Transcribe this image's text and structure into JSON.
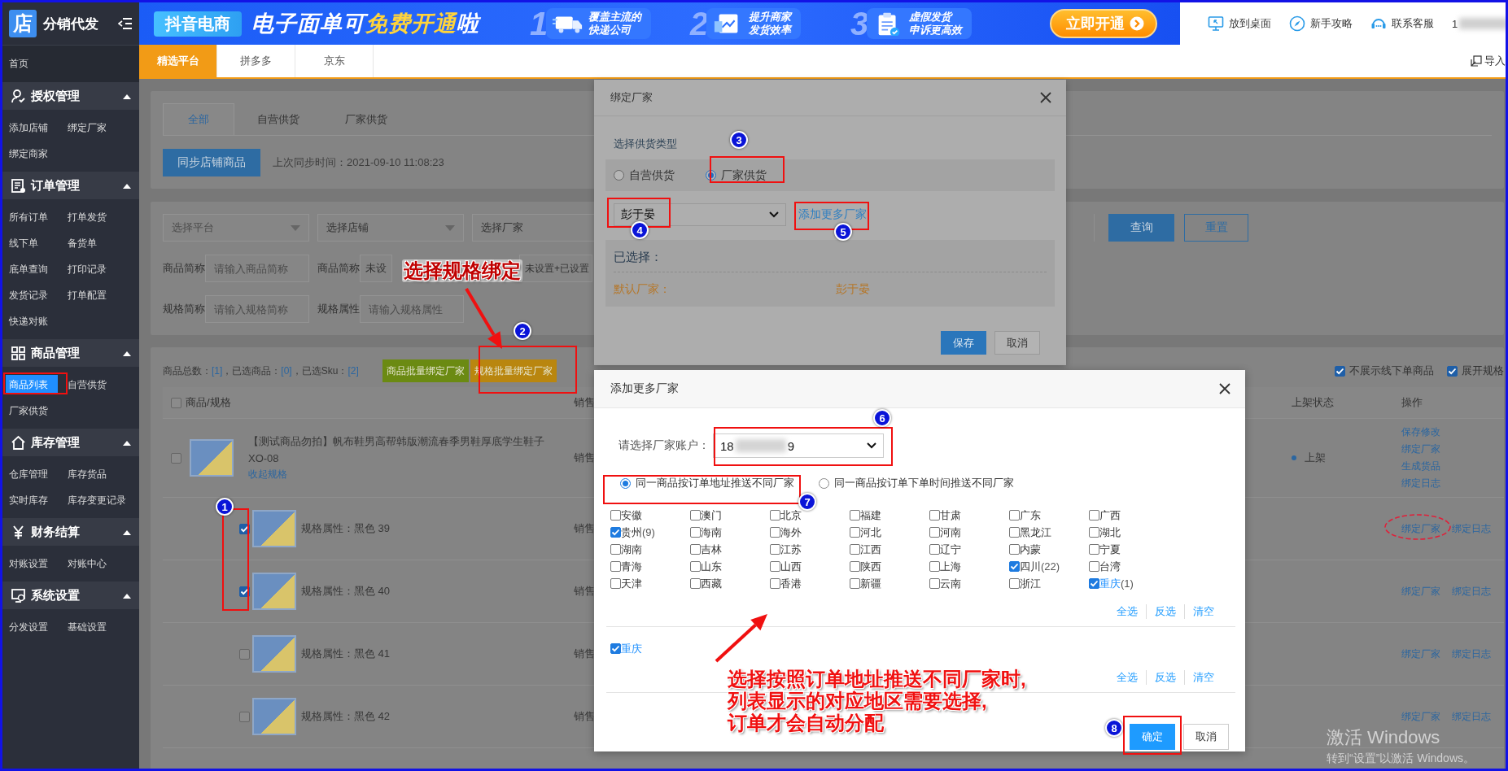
{
  "app": {
    "logo_glyph": "店",
    "title": "分销代发"
  },
  "banner": {
    "brand": "抖音电商",
    "headline": [
      {
        "text": "电子面单可",
        "highlight": false
      },
      {
        "text": "免费开通",
        "highlight": true
      },
      {
        "text": "啦",
        "highlight": false
      }
    ],
    "features": [
      {
        "number": "1",
        "lines": [
          "覆盖主流的",
          "快递公司"
        ]
      },
      {
        "number": "2",
        "lines": [
          "提升商家",
          "发货效率"
        ]
      },
      {
        "number": "3",
        "lines": [
          "虚假发货",
          "申诉更高效"
        ]
      }
    ],
    "cta": "立即开通"
  },
  "header_links": [
    {
      "label": "放到桌面"
    },
    {
      "label": "新手攻略"
    },
    {
      "label": "联系客服"
    }
  ],
  "user": {
    "phone_visible": "1"
  },
  "platform_tabs": [
    {
      "label": "精选平台",
      "selected": true
    },
    {
      "label": "拼多多",
      "selected": false
    },
    {
      "label": "京东",
      "selected": false
    }
  ],
  "import_button": "导入",
  "sidebar": {
    "home": "首页",
    "groups": [
      {
        "title": "授权管理",
        "expanded": true,
        "items": [
          {
            "label": "添加店铺",
            "selected": false
          },
          {
            "label": "绑定厂家",
            "selected": false
          },
          {
            "label": "绑定商家",
            "selected": false
          }
        ]
      },
      {
        "title": "订单管理",
        "expanded": true,
        "items": [
          {
            "label": "所有订单",
            "selected": false
          },
          {
            "label": "打单发货",
            "selected": false
          },
          {
            "label": "线下单",
            "selected": false
          },
          {
            "label": "备货单",
            "selected": false
          },
          {
            "label": "底单查询",
            "selected": false
          },
          {
            "label": "打印记录",
            "selected": false
          },
          {
            "label": "发货记录",
            "selected": false
          },
          {
            "label": "打单配置",
            "selected": false
          },
          {
            "label": "快递对账",
            "selected": false
          }
        ]
      },
      {
        "title": "商品管理",
        "expanded": true,
        "items": [
          {
            "label": "商品列表",
            "selected": true
          },
          {
            "label": "自营供货",
            "selected": false
          },
          {
            "label": "厂家供货",
            "selected": false
          }
        ]
      },
      {
        "title": "库存管理",
        "expanded": true,
        "items": [
          {
            "label": "仓库管理",
            "selected": false
          },
          {
            "label": "库存货品",
            "selected": false
          },
          {
            "label": "实时库存",
            "selected": false
          },
          {
            "label": "库存变更记录",
            "selected": false
          }
        ]
      },
      {
        "title": "财务结算",
        "expanded": true,
        "items": [
          {
            "label": "对账设置",
            "selected": false
          },
          {
            "label": "对账中心",
            "selected": false
          }
        ]
      },
      {
        "title": "系统设置",
        "expanded": true,
        "items": [
          {
            "label": "分发设置",
            "selected": false
          },
          {
            "label": "基础设置",
            "selected": false
          }
        ]
      }
    ]
  },
  "supply_tabs": [
    {
      "label": "全部",
      "selected": true
    },
    {
      "label": "自营供货",
      "selected": false
    },
    {
      "label": "厂家供货",
      "selected": false
    }
  ],
  "sync_button": "同步店铺商品",
  "last_sync": "上次同步时间：2021-09-10 11:08:23",
  "filters": {
    "rows": [
      {
        "fields": [
          {
            "kind": "select",
            "placeholder": "选择平台"
          },
          {
            "kind": "select",
            "value": "选择店铺"
          },
          {
            "kind": "select",
            "value": "选择厂家"
          }
        ]
      },
      {
        "fields": [
          {
            "kind": "label",
            "text": "商品简称"
          },
          {
            "kind": "input",
            "placeholder": "请输入商品简称"
          },
          {
            "kind": "label",
            "text": "商品简称"
          },
          {
            "kind": "select",
            "value": "未设"
          },
          {
            "kind": "select",
            "value": "未设置+已设置"
          }
        ]
      },
      {
        "fields": [
          {
            "kind": "label",
            "text": "规格简称"
          },
          {
            "kind": "input",
            "placeholder": "请输入规格简称"
          },
          {
            "kind": "label",
            "text": "规格属性"
          },
          {
            "kind": "input",
            "placeholder": "请输入规格属性"
          }
        ]
      }
    ],
    "query_button": "查询",
    "reset_button": "重置"
  },
  "table": {
    "summary": [
      {
        "text": "商品总数：",
        "kind": "label"
      },
      {
        "text": "[1]",
        "kind": "count"
      },
      {
        "text": "，已选商品：",
        "kind": "label"
      },
      {
        "text": "[0]",
        "kind": "count"
      },
      {
        "text": "，已选Sku：",
        "kind": "label"
      },
      {
        "text": "[2]",
        "kind": "count"
      }
    ],
    "batch_buttons": [
      {
        "label": "商品批量绑定厂家",
        "color": "#6b8a12"
      },
      {
        "label": "规格批量绑定厂家",
        "color": "#b9860f"
      }
    ],
    "options": [
      {
        "label": "不展示线下单商品",
        "checked": true
      },
      {
        "label": "展开规格",
        "checked": true
      }
    ],
    "header_checked": false,
    "columns": [
      "商品/规格",
      "销售",
      "上架状态",
      "操作"
    ],
    "product": {
      "checked": false,
      "title": "【测试商品勿拍】帆布鞋男高帮韩版潮流春季男鞋厚底学生鞋子",
      "code": "XO-08",
      "collapse_link": "收起规格",
      "column_2": "销售",
      "status": "上架",
      "actions": [
        "保存修改",
        "绑定厂家",
        "生成货品",
        "绑定日志"
      ]
    },
    "skus": [
      {
        "checked": true,
        "attribute": "规格属性：黑色 39",
        "column_2": "销售",
        "actions": [
          "绑定厂家",
          "绑定日志"
        ]
      },
      {
        "checked": true,
        "attribute": "规格属性：黑色 40",
        "column_2": "销售",
        "actions": [
          "绑定厂家",
          "绑定日志"
        ]
      },
      {
        "checked": false,
        "attribute": "规格属性：黑色 41",
        "column_2": "销售",
        "actions": [
          "绑定厂家",
          "绑定日志"
        ]
      },
      {
        "checked": false,
        "attribute": "规格属性：黑色 42",
        "column_2": "销售",
        "actions": [
          "绑定厂家",
          "绑定日志"
        ]
      }
    ]
  },
  "bind_dialog": {
    "title": "绑定厂家",
    "section_label": "选择供货类型",
    "supply_types": [
      {
        "label": "自营供货",
        "selected": false
      },
      {
        "label": "厂家供货",
        "selected": true
      }
    ],
    "factory_select": "彭于晏",
    "add_more_link": "添加更多厂家",
    "selected_label": "已选择：",
    "selected_rows": [
      {
        "label": "默认厂家：",
        "value": "彭于晏"
      }
    ],
    "buttons": [
      {
        "label": "保存",
        "kind": "primary"
      },
      {
        "label": "取消",
        "kind": "secondary"
      }
    ]
  },
  "more_dialog": {
    "title": "添加更多厂家",
    "account_label": "请选择厂家账户：",
    "account_visible_start": "18",
    "account_visible_end": "9",
    "push_modes": [
      {
        "label": "同一商品按订单地址推送不同厂家",
        "selected": true
      },
      {
        "label": "同一商品按订单下单时间推送不同厂家",
        "selected": false
      }
    ],
    "regions": [
      {
        "name": "安徽",
        "checked": false,
        "active": false
      },
      {
        "name": "澳门",
        "checked": false,
        "active": false
      },
      {
        "name": "北京",
        "checked": false,
        "active": false
      },
      {
        "name": "福建",
        "checked": false,
        "active": false
      },
      {
        "name": "甘肃",
        "checked": false,
        "active": false
      },
      {
        "name": "广东",
        "checked": false,
        "active": false
      },
      {
        "name": "广西",
        "checked": false,
        "active": false
      },
      {
        "name": "贵州",
        "count": "(9)",
        "checked": true,
        "active": false
      },
      {
        "name": "海南",
        "checked": false,
        "active": false
      },
      {
        "name": "海外",
        "checked": false,
        "active": false
      },
      {
        "name": "河北",
        "checked": false,
        "active": false
      },
      {
        "name": "河南",
        "checked": false,
        "active": false
      },
      {
        "name": "黑龙江",
        "checked": false,
        "active": false
      },
      {
        "name": "湖北",
        "checked": false,
        "active": false
      },
      {
        "name": "湖南",
        "checked": false,
        "active": false
      },
      {
        "name": "吉林",
        "checked": false,
        "active": false
      },
      {
        "name": "江苏",
        "checked": false,
        "active": false
      },
      {
        "name": "江西",
        "checked": false,
        "active": false
      },
      {
        "name": "辽宁",
        "checked": false,
        "active": false
      },
      {
        "name": "内蒙",
        "checked": false,
        "active": false
      },
      {
        "name": "宁夏",
        "checked": false,
        "active": false
      },
      {
        "name": "青海",
        "checked": false,
        "active": false
      },
      {
        "name": "山东",
        "checked": false,
        "active": false
      },
      {
        "name": "山西",
        "checked": false,
        "active": false
      },
      {
        "name": "陕西",
        "checked": false,
        "active": false
      },
      {
        "name": "上海",
        "checked": false,
        "active": false
      },
      {
        "name": "四川",
        "count": "(22)",
        "checked": true,
        "active": false
      },
      {
        "name": "台湾",
        "checked": false,
        "active": false
      },
      {
        "name": "天津",
        "checked": false,
        "active": false
      },
      {
        "name": "西藏",
        "checked": false,
        "active": false
      },
      {
        "name": "香港",
        "checked": false,
        "active": false
      },
      {
        "name": "新疆",
        "checked": false,
        "active": false
      },
      {
        "name": "云南",
        "checked": false,
        "active": false
      },
      {
        "name": "浙江",
        "checked": false,
        "active": false
      },
      {
        "name": "重庆",
        "count": "(1)",
        "checked": true,
        "active": true
      }
    ],
    "region_links": [
      "全选",
      "反选",
      "清空"
    ],
    "chosen": [
      {
        "name": "重庆",
        "checked": true
      }
    ],
    "chosen_links": [
      "全选",
      "反选",
      "清空"
    ],
    "buttons": [
      {
        "label": "确定",
        "kind": "primary"
      },
      {
        "label": "取消",
        "kind": "secondary"
      }
    ]
  },
  "annotations": {
    "badges": [
      "1",
      "2",
      "3",
      "4",
      "5",
      "6",
      "7",
      "8"
    ],
    "notes": [
      {
        "lines": [
          "选择规格绑定"
        ]
      },
      {
        "lines": [
          "选择按照订单地址推送不同厂家时,",
          "列表显示的对应地区需要选择,",
          "订单才会自动分配"
        ]
      }
    ]
  },
  "os_notice": {
    "title": "激活 Windows",
    "hint": "转到“设置”以激活 Windows。"
  }
}
